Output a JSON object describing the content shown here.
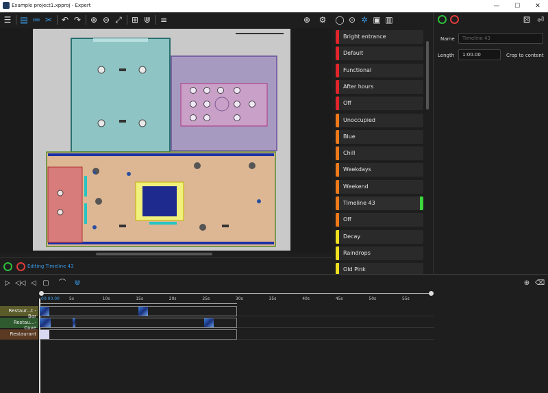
{
  "window": {
    "title": "Example project1.xpproj - Expert",
    "minimize": "—",
    "maximize": "☐",
    "close": "✕"
  },
  "editbar": {
    "status": "Editing Timeline 43"
  },
  "scenes": [
    {
      "label": "Bright entrance",
      "color": "#e0252b"
    },
    {
      "label": "Default",
      "color": "#e0252b"
    },
    {
      "label": "Functional",
      "color": "#e0252b"
    },
    {
      "label": "After hours",
      "color": "#e0252b"
    },
    {
      "label": "Off",
      "color": "#e0252b"
    },
    {
      "label": "Unoccupied",
      "color": "#f07a1a"
    },
    {
      "label": "Blue",
      "color": "#f07a1a"
    },
    {
      "label": "Chill",
      "color": "#f07a1a"
    },
    {
      "label": "Weekdays",
      "color": "#f07a1a"
    },
    {
      "label": "Weekend",
      "color": "#f07a1a"
    },
    {
      "label": "Timeline 43",
      "color": "#f07a1a",
      "selected": true
    },
    {
      "label": "Off",
      "color": "#f07a1a"
    },
    {
      "label": "Decay",
      "color": "#f0e020"
    },
    {
      "label": "Raindrops",
      "color": "#f0e020"
    },
    {
      "label": "Old Pink",
      "color": "#f0e020"
    }
  ],
  "props": {
    "name_label": "Name",
    "name_placeholder": "Timeline 43",
    "length_label": "Length",
    "length_value": "1:00.00",
    "crop_label": "Crop to content"
  },
  "timeline": {
    "start": "00:00.00",
    "ticks": [
      "5s",
      "10s",
      "15s",
      "20s",
      "25s",
      "30s",
      "35s",
      "40s",
      "45s",
      "50s",
      "55s"
    ],
    "tracks": [
      {
        "label": "Restaur...t - Bar",
        "color": "#5b5b2a"
      },
      {
        "label": "Restau...- Cove",
        "color": "#2f5a2f"
      },
      {
        "label": "Restaurant",
        "color": "#5a3a22"
      }
    ]
  }
}
